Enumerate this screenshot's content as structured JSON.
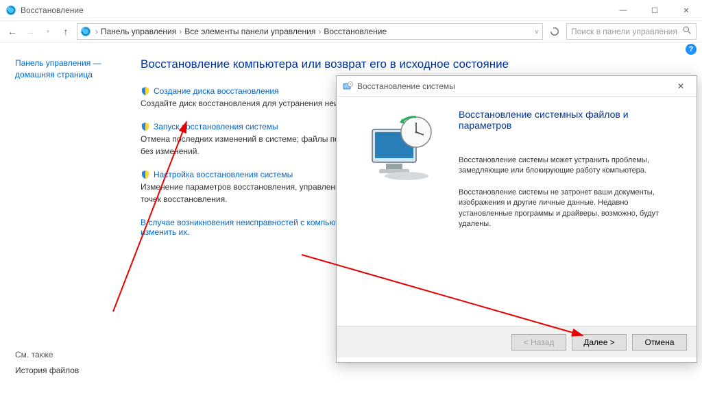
{
  "window": {
    "title": "Восстановление",
    "min": "—",
    "max": "☐",
    "close": "✕"
  },
  "breadcrumb": {
    "item1": "Панель управления",
    "item2": "Все элементы панели управления",
    "item3": "Восстановление"
  },
  "search": {
    "placeholder": "Поиск в панели управления"
  },
  "sidebar": {
    "home": "Панель управления — домашняя страница",
    "seealso_label": "См. также",
    "seealso_link": "История файлов"
  },
  "main": {
    "heading": "Восстановление компьютера или возврат его в исходное состояние",
    "items": [
      {
        "title": "Создание диска восстановления",
        "desc": "Создайте диск восстановления для устранения неисправностей…"
      },
      {
        "title": "Запуск восстановления системы",
        "desc": "Отмена последних изменений в системе; файлы пользователей, документы, фотографии и музыка, останутся без изменений."
      },
      {
        "title": "Настройка восстановления системы",
        "desc": "Изменение параметров восстановления, управление дисковым пространством, а также создание и удаление точек восстановления."
      }
    ],
    "footnote_prefix": "В случае возникновения неисправностей с компьютером откройте страницу «Параметры» и попробуйте ",
    "footnote_link": "изменить их."
  },
  "dialog": {
    "title": "Восстановление системы",
    "heading": "Восстановление системных файлов и параметров",
    "para1": "Восстановление системы может устранить проблемы, замедляющие или блокирующие работу компьютера.",
    "para2": "Восстановление системы не затронет ваши документы, изображения и другие личные данные. Недавно установленные программы и драйверы, возможно, будут удалены.",
    "back": "< Назад",
    "next": "Далее >",
    "cancel": "Отмена"
  }
}
